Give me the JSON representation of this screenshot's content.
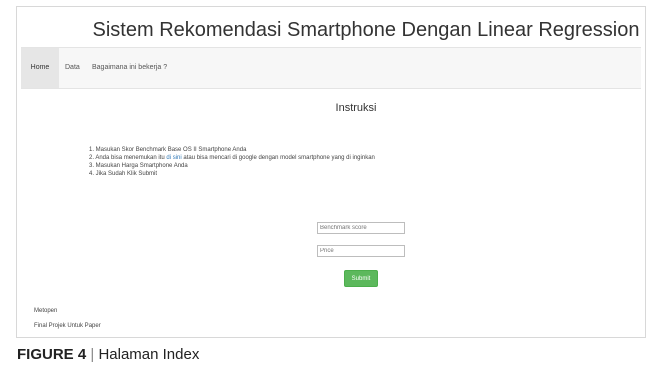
{
  "app": {
    "title": "Sistem Rekomendasi Smartphone Dengan Linear Regression"
  },
  "nav": {
    "items": [
      "Home",
      "Data",
      "Bagaimana ini bekerja ?"
    ]
  },
  "instructions": {
    "title": "Instruksi",
    "step1": "1. Masukan Skor Benchmark Base OS II Smartphone Anda",
    "step2_before": "2. Anda bisa menemukan itu ",
    "step2_link": "di sini",
    "step2_after": " atau bisa mencari di google dengan model smartphone yang di inginkan",
    "step3": "3. Masukan Harga Smartphone Anda",
    "step4": "4. Jika Sudah Klik Submit"
  },
  "form": {
    "benchmark_placeholder": "Benchmark score",
    "price_placeholder": "Price",
    "submit_label": "Submit"
  },
  "footer": {
    "name": "Metopen",
    "subtitle": "Final Projek Untuk Paper"
  },
  "caption": {
    "label": "FIGURE 4",
    "separator": "|",
    "text": "Halaman Index"
  },
  "colors": {
    "accent": "#5cb85c",
    "link": "#337ab7",
    "navbar": "#f7f7f7"
  }
}
